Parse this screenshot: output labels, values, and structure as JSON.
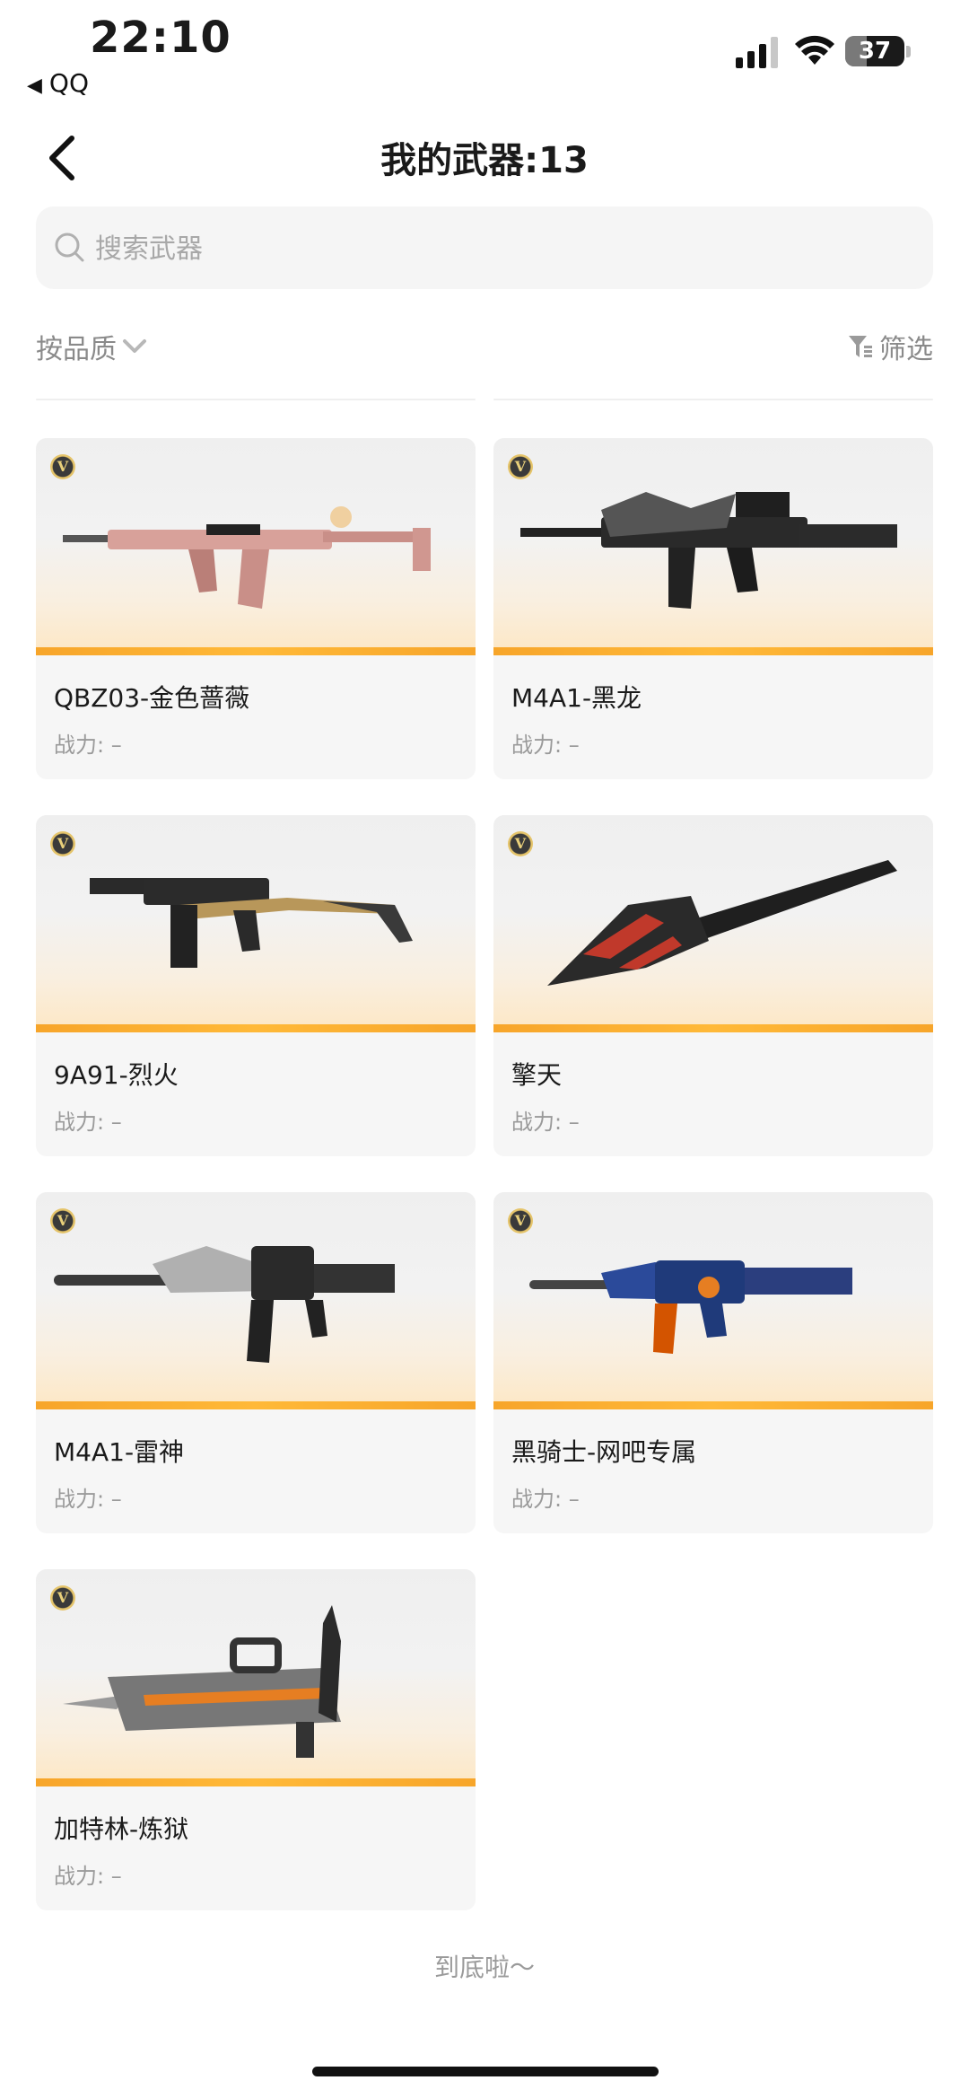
{
  "status_bar": {
    "time": "22:10",
    "back_app": "QQ",
    "battery": "37",
    "battery_level": 0.37
  },
  "header": {
    "title": "我的武器:13"
  },
  "search": {
    "placeholder": "搜索武器"
  },
  "toolbar": {
    "sort_label": "按品质",
    "filter_label": "筛选"
  },
  "cards": [
    {
      "badge": "V",
      "name": "QBZ03-金色蔷薇",
      "power": "战力: –",
      "weapon_icon": "rifle-pink"
    },
    {
      "badge": "V",
      "name": "M4A1-黑龙",
      "power": "战力: –",
      "weapon_icon": "rifle-dragon"
    },
    {
      "badge": "V",
      "name": "9A91-烈火",
      "power": "战力: –",
      "weapon_icon": "smg-gold"
    },
    {
      "badge": "V",
      "name": "擎天",
      "power": "战力: –",
      "weapon_icon": "shovel-black"
    },
    {
      "badge": "V",
      "name": "M4A1-雷神",
      "power": "战力: –",
      "weapon_icon": "rifle-silver"
    },
    {
      "badge": "V",
      "name": "黑骑士-网吧专属",
      "power": "战力: –",
      "weapon_icon": "rifle-blue"
    },
    {
      "badge": "V",
      "name": "加特林-炼狱",
      "power": "战力: –",
      "weapon_icon": "gatling-silver"
    }
  ],
  "footer": {
    "end_text": "到底啦～"
  },
  "colors": {
    "accent": "#f7a52a",
    "card_bg": "#f6f6f6",
    "muted": "#9a9a9a"
  }
}
